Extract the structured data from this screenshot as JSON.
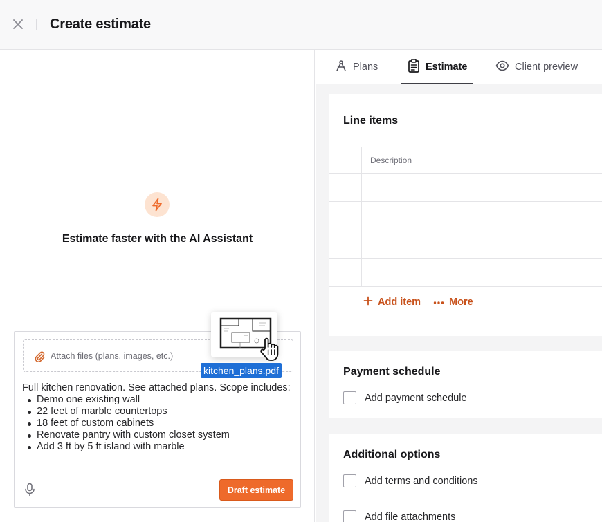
{
  "header": {
    "title": "Create estimate",
    "close_icon": "close-icon"
  },
  "ai": {
    "icon": "lightning-icon",
    "heading": "Estimate faster with the AI Assistant"
  },
  "composer": {
    "attach_placeholder": "Attach files (plans, images, etc.)",
    "prompt_intro": "Full kitchen renovation. See attached plans. Scope includes:",
    "scope_items": [
      "Demo one existing wall",
      "22 feet of marble countertops",
      "18 feet of custom cabinets",
      "Renovate pantry with custom closet system",
      "Add 3 ft by 5 ft island with marble"
    ],
    "draft_button": "Draft estimate",
    "mic_icon": "microphone-icon"
  },
  "drag": {
    "file_name": "kitchen_plans.pdf"
  },
  "tabs": [
    {
      "label": "Plans",
      "icon": "compass-icon"
    },
    {
      "label": "Estimate",
      "icon": "clipboard-icon",
      "active": true
    },
    {
      "label": "Client preview",
      "icon": "eye-icon"
    }
  ],
  "line_items": {
    "title": "Line items",
    "column_description": "Description",
    "add_item": "Add item",
    "more": "More"
  },
  "payment": {
    "title": "Payment schedule",
    "option": "Add payment schedule"
  },
  "additional": {
    "title": "Additional options",
    "options": [
      "Add terms and conditions",
      "Add file attachments"
    ]
  },
  "colors": {
    "accent": "#ee6a2b",
    "accent_text": "#c8521c",
    "chip_blue": "#1f6fd6"
  }
}
